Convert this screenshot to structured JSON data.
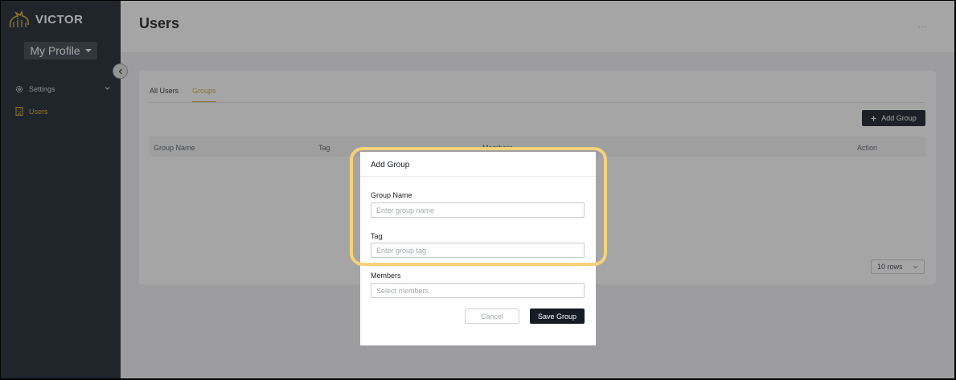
{
  "brand": {
    "name": "VICTOR",
    "accent": "#d9a92e"
  },
  "profile": {
    "label": "My Profile"
  },
  "sidebar": {
    "items": [
      {
        "label": "Settings",
        "icon": "gear-icon",
        "expandable": true
      },
      {
        "label": "Users",
        "icon": "building-icon",
        "active": true
      }
    ]
  },
  "header": {
    "title": "Users",
    "more": "..."
  },
  "tabs": [
    {
      "label": "All Users",
      "active": false
    },
    {
      "label": "Groups",
      "active": true
    }
  ],
  "toolbar": {
    "add_group_label": "Add Group"
  },
  "table": {
    "columns": [
      "Group Name",
      "Tag",
      "Members",
      "Action"
    ]
  },
  "pagination": {
    "rows_label": "10 rows"
  },
  "modal": {
    "title": "Add Group",
    "fields": [
      {
        "label": "Group Name",
        "placeholder": "Enter group name",
        "value": ""
      },
      {
        "label": "Tag",
        "placeholder": "Enter group tag",
        "value": ""
      },
      {
        "label": "Members",
        "placeholder": "Select members",
        "value": ""
      }
    ],
    "cancel_label": "Cancel",
    "save_label": "Save Group"
  },
  "colors": {
    "sidebar_bg": "#1b2430",
    "primary_button": "#161c26",
    "highlight": "#f6d27a"
  }
}
